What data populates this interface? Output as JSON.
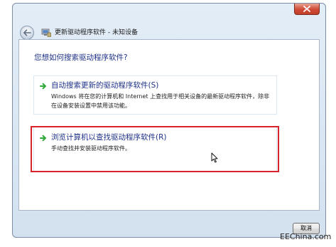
{
  "window": {
    "title": "更新驱动程序软件 - 未知设备"
  },
  "main": {
    "heading": "您想如何搜索驱动程序软件?",
    "options": [
      {
        "title": "自动搜索更新的驱动程序软件(S)",
        "description": "Windows 将在您的计算机和 Internet 上查找用于相关设备的最新驱动程序软件，除非在设备安装设置中禁用该功能。"
      },
      {
        "title": "浏览计算机以查找驱动程序软件(R)",
        "description": "手动查找并安装驱动程序软件。"
      }
    ]
  },
  "footer": {
    "cancel_label": "取消"
  },
  "watermark": {
    "text": "EEChina.com"
  },
  "colors": {
    "link_blue": "#1e3287",
    "highlight_red": "#d9232c",
    "arrow_green": "#2fa83a",
    "close_red": "#c9432f"
  },
  "icons": {
    "close": "close-icon",
    "back": "back-arrow-icon",
    "device": "device-manager-icon",
    "option_arrow": "green-arrow-icon",
    "cursor": "mouse-pointer-icon"
  }
}
